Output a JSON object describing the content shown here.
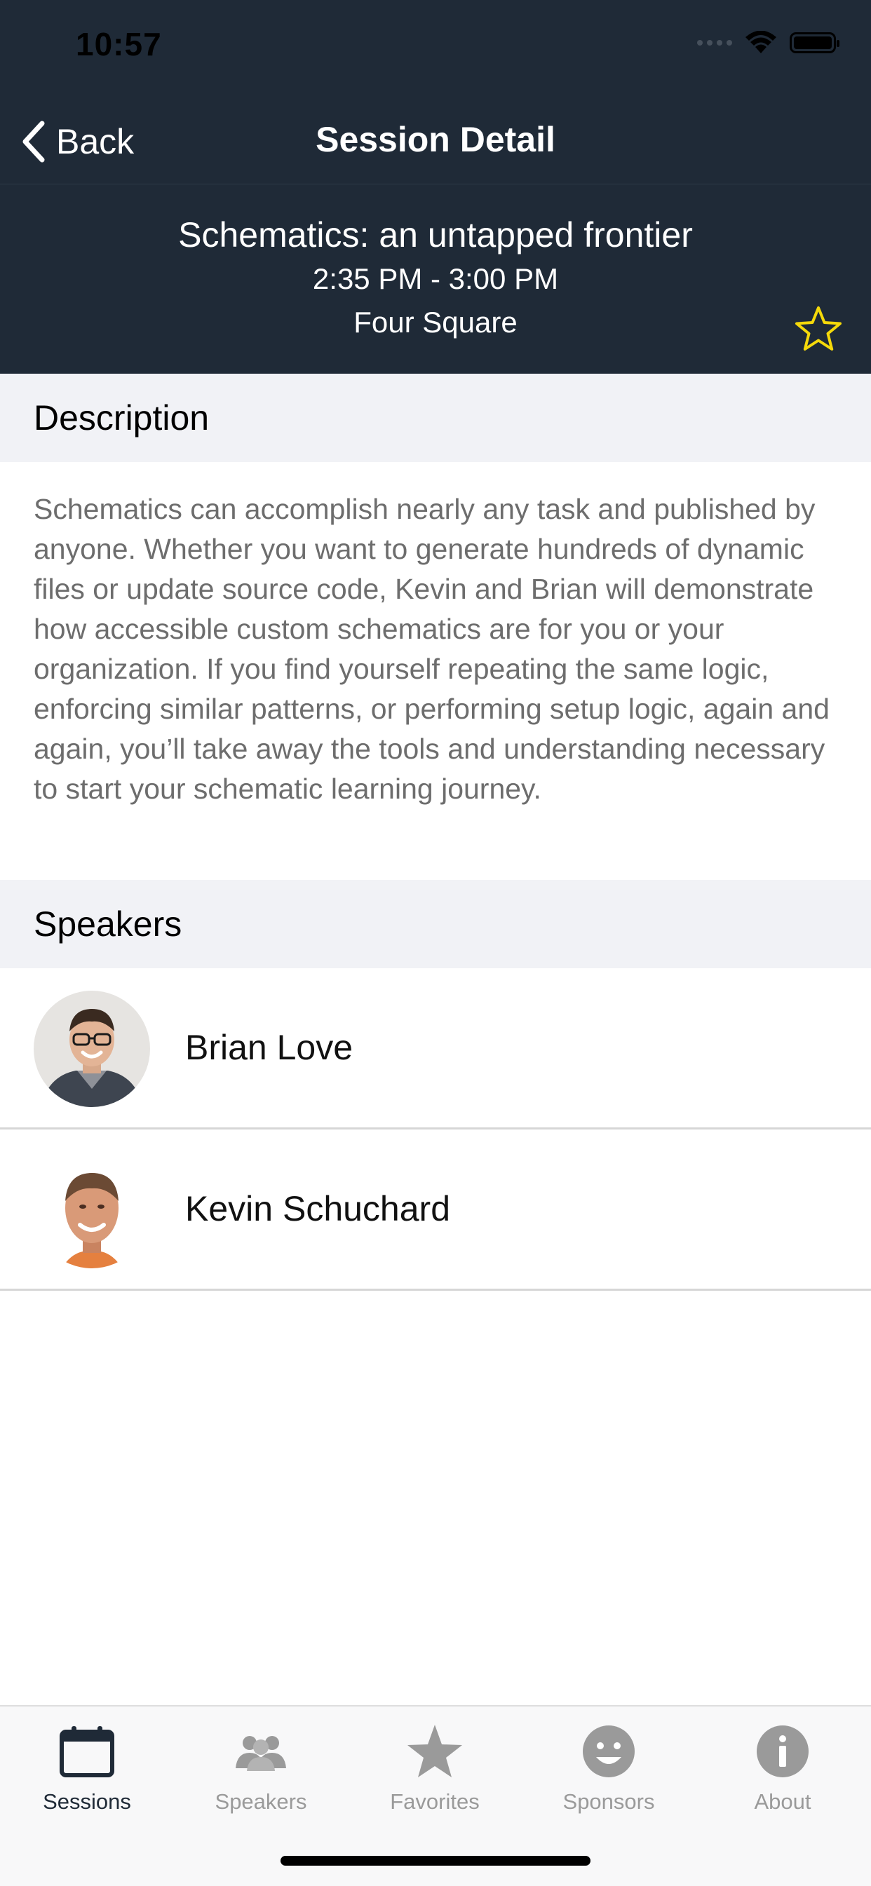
{
  "status_bar": {
    "time": "10:57"
  },
  "nav": {
    "back_label": "Back",
    "title": "Session Detail"
  },
  "session": {
    "title": "Schematics: an untapped frontier",
    "time": "2:35 PM - 3:00 PM",
    "room": "Four Square",
    "favorite_icon": "star-outline-icon",
    "favorite_color": "#f5d90a"
  },
  "description": {
    "header": "Description",
    "text": "Schematics can accomplish nearly any task and published by anyone. Whether you want to generate hundreds of dynamic files or update source code, Kevin and Brian will demonstrate how accessible custom schematics are for you or your organization. If you find yourself repeating the same logic, enforcing similar patterns, or performing setup logic, again and again, you’ll take away the tools and understanding necessary to start your schematic learning journey."
  },
  "speakers": {
    "header": "Speakers",
    "items": [
      {
        "name": "Brian Love"
      },
      {
        "name": "Kevin Schuchard"
      }
    ]
  },
  "tabbar": {
    "items": [
      {
        "label": "Sessions",
        "icon": "calendar-icon",
        "active": true
      },
      {
        "label": "Speakers",
        "icon": "people-icon",
        "active": false
      },
      {
        "label": "Favorites",
        "icon": "star-icon",
        "active": false
      },
      {
        "label": "Sponsors",
        "icon": "smiley-icon",
        "active": false
      },
      {
        "label": "About",
        "icon": "info-icon",
        "active": false
      }
    ]
  },
  "colors": {
    "header_bg": "#1f2a37",
    "section_bg": "#f1f2f6",
    "tab_active": "#1f2a37",
    "tab_inactive": "#9a9a9a"
  }
}
